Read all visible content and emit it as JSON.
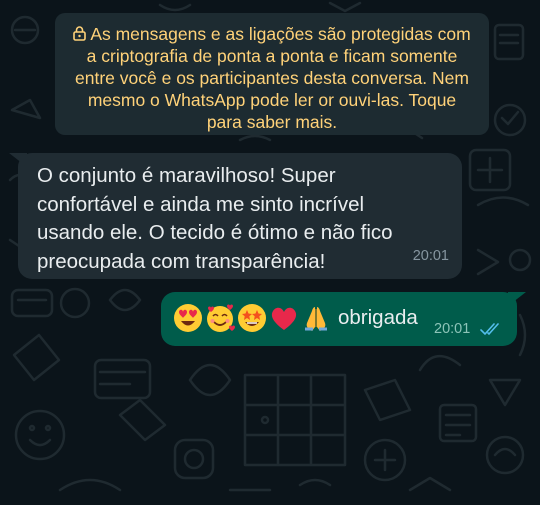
{
  "colors": {
    "background": "#0b141a",
    "notice_bg": "#1d2b31",
    "notice_text": "#ffd279",
    "incoming_bubble": "#202c33",
    "outgoing_bubble": "#005c4b",
    "message_text": "#e9edef",
    "read_receipt": "#53bdeb"
  },
  "encryption_notice": {
    "icon": "lock-icon",
    "lines": [
      "As mensagens e as ligações são protegidas com",
      "a criptografia de ponta a ponta e ficam somente",
      "entre você e os participantes desta conversa. Nem",
      "mesmo o WhatsApp pode ler or ouvi-las. Toque",
      "para saber mais."
    ]
  },
  "messages": [
    {
      "direction": "incoming",
      "lines": [
        "O conjunto é maravilhoso! Super",
        "confortável e ainda me sinto incrível",
        "usando ele. O tecido é ótimo e não fico",
        "preocupada com transparência!"
      ],
      "time": "20:01"
    },
    {
      "direction": "outgoing",
      "emojis": [
        "heart-eyes-emoji",
        "smiling-face-with-hearts-emoji",
        "star-struck-emoji",
        "red-heart-emoji",
        "folded-hands-emoji"
      ],
      "text": "obrigada",
      "time": "20:01",
      "status_icon": "double-check-read-icon"
    }
  ]
}
